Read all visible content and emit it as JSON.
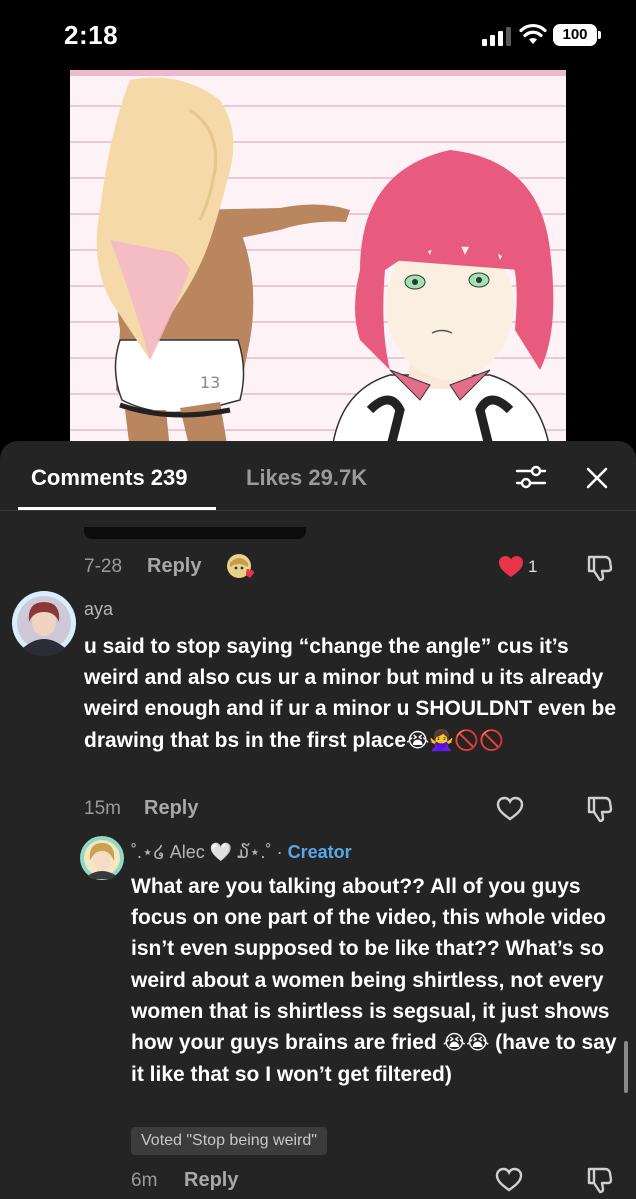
{
  "status_bar": {
    "time": "2:18",
    "battery": "100",
    "icons": [
      "cellular-signal-icon",
      "wifi-icon",
      "battery-icon"
    ]
  },
  "video": {
    "artwork_text": "13"
  },
  "comments_panel": {
    "tabs": [
      {
        "label": "Comments 239",
        "active": true
      },
      {
        "label": "Likes 29.7K",
        "active": false
      }
    ],
    "filter_icon": "sliders-icon",
    "close_icon": "close-icon"
  },
  "prev_comment": {
    "date": "7-28",
    "reply_label": "Reply",
    "like_count": "1",
    "liked_color": "#e8334a"
  },
  "comment_aya": {
    "author": "aya",
    "text": "u said to stop saying “change the angle” cus it’s weird and also cus ur a minor but mind u its already weird enough and if ur a minor u SHOULDNT even be drawing that bs in the first place",
    "emojis": "😭🙅‍♀️🚫🚫",
    "time": "15m",
    "reply_label": "Reply"
  },
  "reply_alec": {
    "author": "˚.⋆໒ Alec 🤍 ໓⋆.˚",
    "separator": "·",
    "creator_label": "Creator",
    "creator_color": "#56a8e6",
    "text_part1": "What are you talking about?? All of you guys focus on one part of the video, this whole video isn’t even supposed to be like that?? What’s so weird about a women being shirtless, not every women that is shirtless is segsual, it just shows how your guys brains are fried ",
    "emojis": "😭😭",
    "text_part2": " (have to say it like that so I won’t get filtered)",
    "voted": "Voted \"Stop being weird\"",
    "time": "6m",
    "reply_label": "Reply"
  }
}
